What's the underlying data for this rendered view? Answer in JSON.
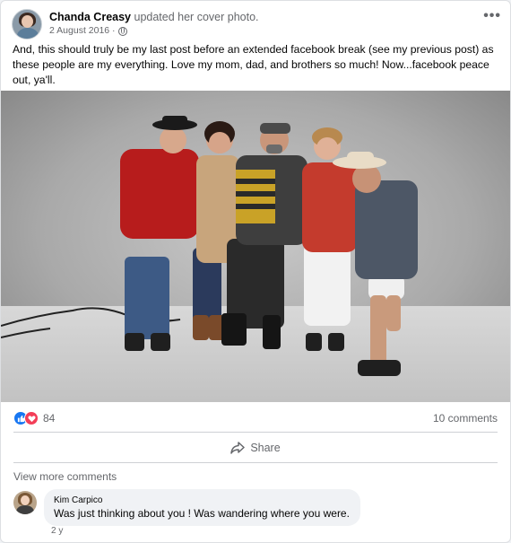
{
  "post": {
    "author": "Chanda Creasy",
    "action": "updated her cover photo.",
    "date": "2 August 2016 ·",
    "text": "And, this should truly be my last post before an extended facebook break (see my previous post) as these people are my everything. Love my mom, dad, and brothers so much! Now...facebook peace out, ya'll.",
    "more_icon": "more-options-icon",
    "privacy_icon": "globe-icon"
  },
  "stats": {
    "reactions_count": "84",
    "comments_count": "10 comments",
    "reaction_icons": [
      "like-icon",
      "love-icon"
    ]
  },
  "actions": {
    "share_label": "Share"
  },
  "comments_section": {
    "view_more": "View more comments",
    "items": [
      {
        "author": "Kim Carpico",
        "text": "Was just thinking about you ! Was wandering where you were.",
        "time": "2 y"
      }
    ]
  },
  "colors": {
    "accent": "#1877f2",
    "love": "#f33e58",
    "secondary_text": "#65676b",
    "divider": "#ced0d4"
  }
}
